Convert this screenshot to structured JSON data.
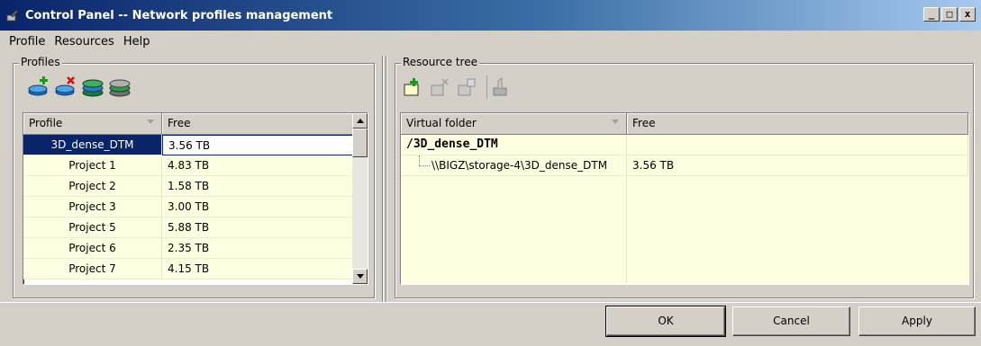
{
  "window": {
    "title": "Control Panel -- Network profiles management",
    "buttons": {
      "minimize": "_",
      "maximize": "□",
      "close": "x"
    }
  },
  "menu": [
    "Profile",
    "Resources",
    "Help"
  ],
  "profiles": {
    "group_label": "Profiles",
    "toolbar_icons": [
      "add-profile-icon",
      "delete-profile-icon",
      "profile-stack-icon",
      "profile-stack-gray-icon"
    ],
    "columns": [
      "Profile",
      "Free"
    ],
    "selected_index": 0,
    "rows": [
      {
        "name": "3D_dense_DTM",
        "free": "3.56 TB"
      },
      {
        "name": "Project 1",
        "free": "4.83 TB"
      },
      {
        "name": "Project 2",
        "free": "1.58 TB"
      },
      {
        "name": "Project 3",
        "free": "3.00 TB"
      },
      {
        "name": "Project 5",
        "free": "5.88 TB"
      },
      {
        "name": "Project 6",
        "free": "2.35 TB"
      },
      {
        "name": "Project 7",
        "free": "4.15 TB"
      }
    ]
  },
  "resources": {
    "group_label": "Resource tree",
    "toolbar_icons": [
      "add-folder-icon",
      "remove-folder-icon",
      "folder-properties-icon",
      "map-resource-icon"
    ],
    "columns": [
      "Virtual folder",
      "Free"
    ],
    "rows": [
      {
        "folder": "/3D_dense_DTM",
        "free": "",
        "level": 0
      },
      {
        "folder": "\\\\BIGZ\\storage-4\\3D_dense_DTM",
        "free": "3.56 TB",
        "level": 1
      }
    ]
  },
  "dialog_buttons": {
    "ok": "OK",
    "cancel": "Cancel",
    "apply": "Apply"
  },
  "colors": {
    "title_start": "#0a246a",
    "title_end": "#a6caf0",
    "row_bg": "#ffffe1",
    "selection": "#0a246a",
    "face": "#d4d0c8"
  }
}
